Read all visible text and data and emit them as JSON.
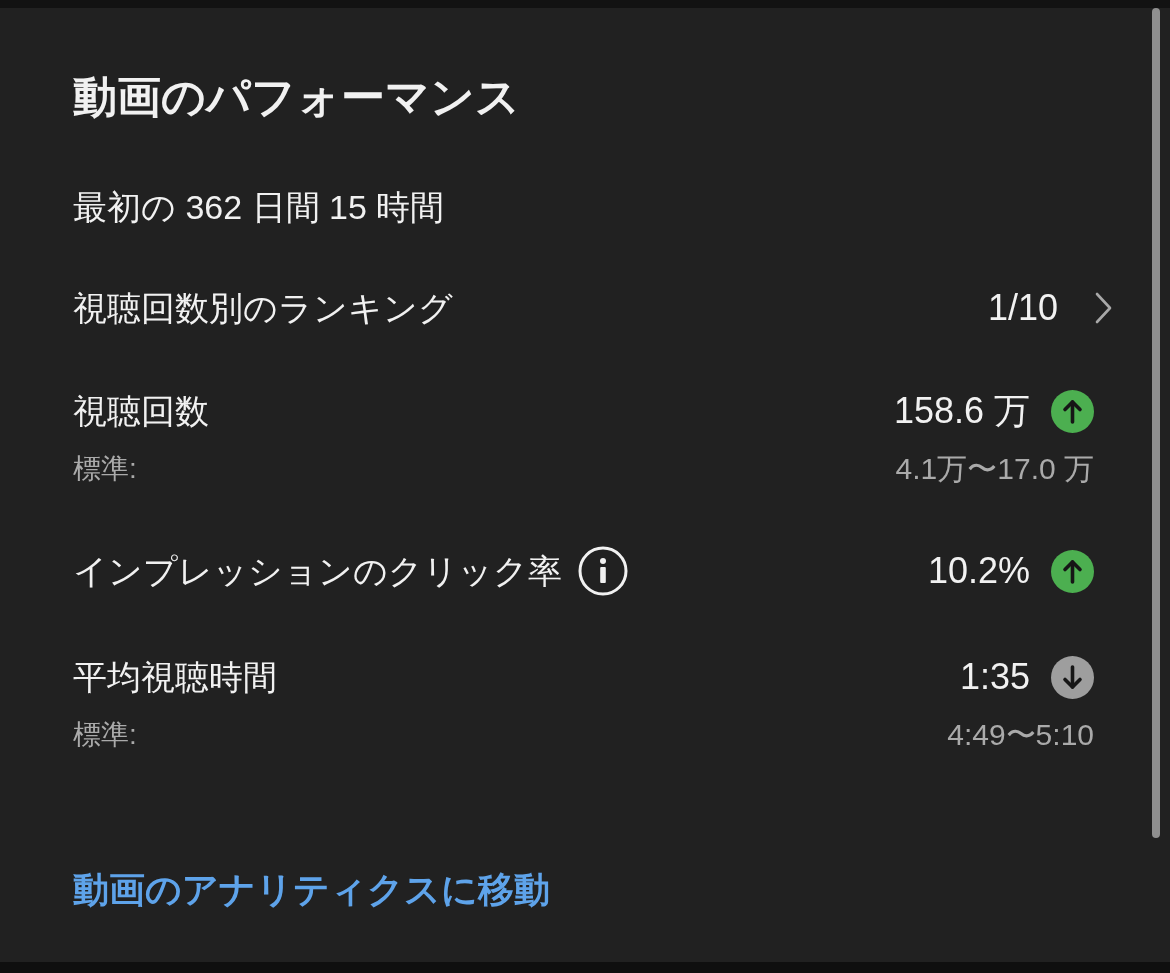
{
  "title": "動画のパフォーマンス",
  "period": "最初の 362 日間 15 時間",
  "ranking": {
    "label": "視聴回数別のランキング",
    "value": "1/10"
  },
  "metrics": [
    {
      "label": "視聴回数",
      "info": false,
      "value": "158.6 万",
      "rising": true,
      "typical_label": "標準:",
      "typical_range": "4.1万〜17.0 万"
    },
    {
      "label": "インプレッションのクリック率",
      "info": true,
      "value": "10.2%",
      "rising": true
    },
    {
      "label": "平均視聴時間",
      "info": false,
      "value": "1:35",
      "rising": false,
      "typical_label": "標準:",
      "typical_range": "4:49〜5:10"
    }
  ],
  "link": "動画のアナリティクスに移動"
}
